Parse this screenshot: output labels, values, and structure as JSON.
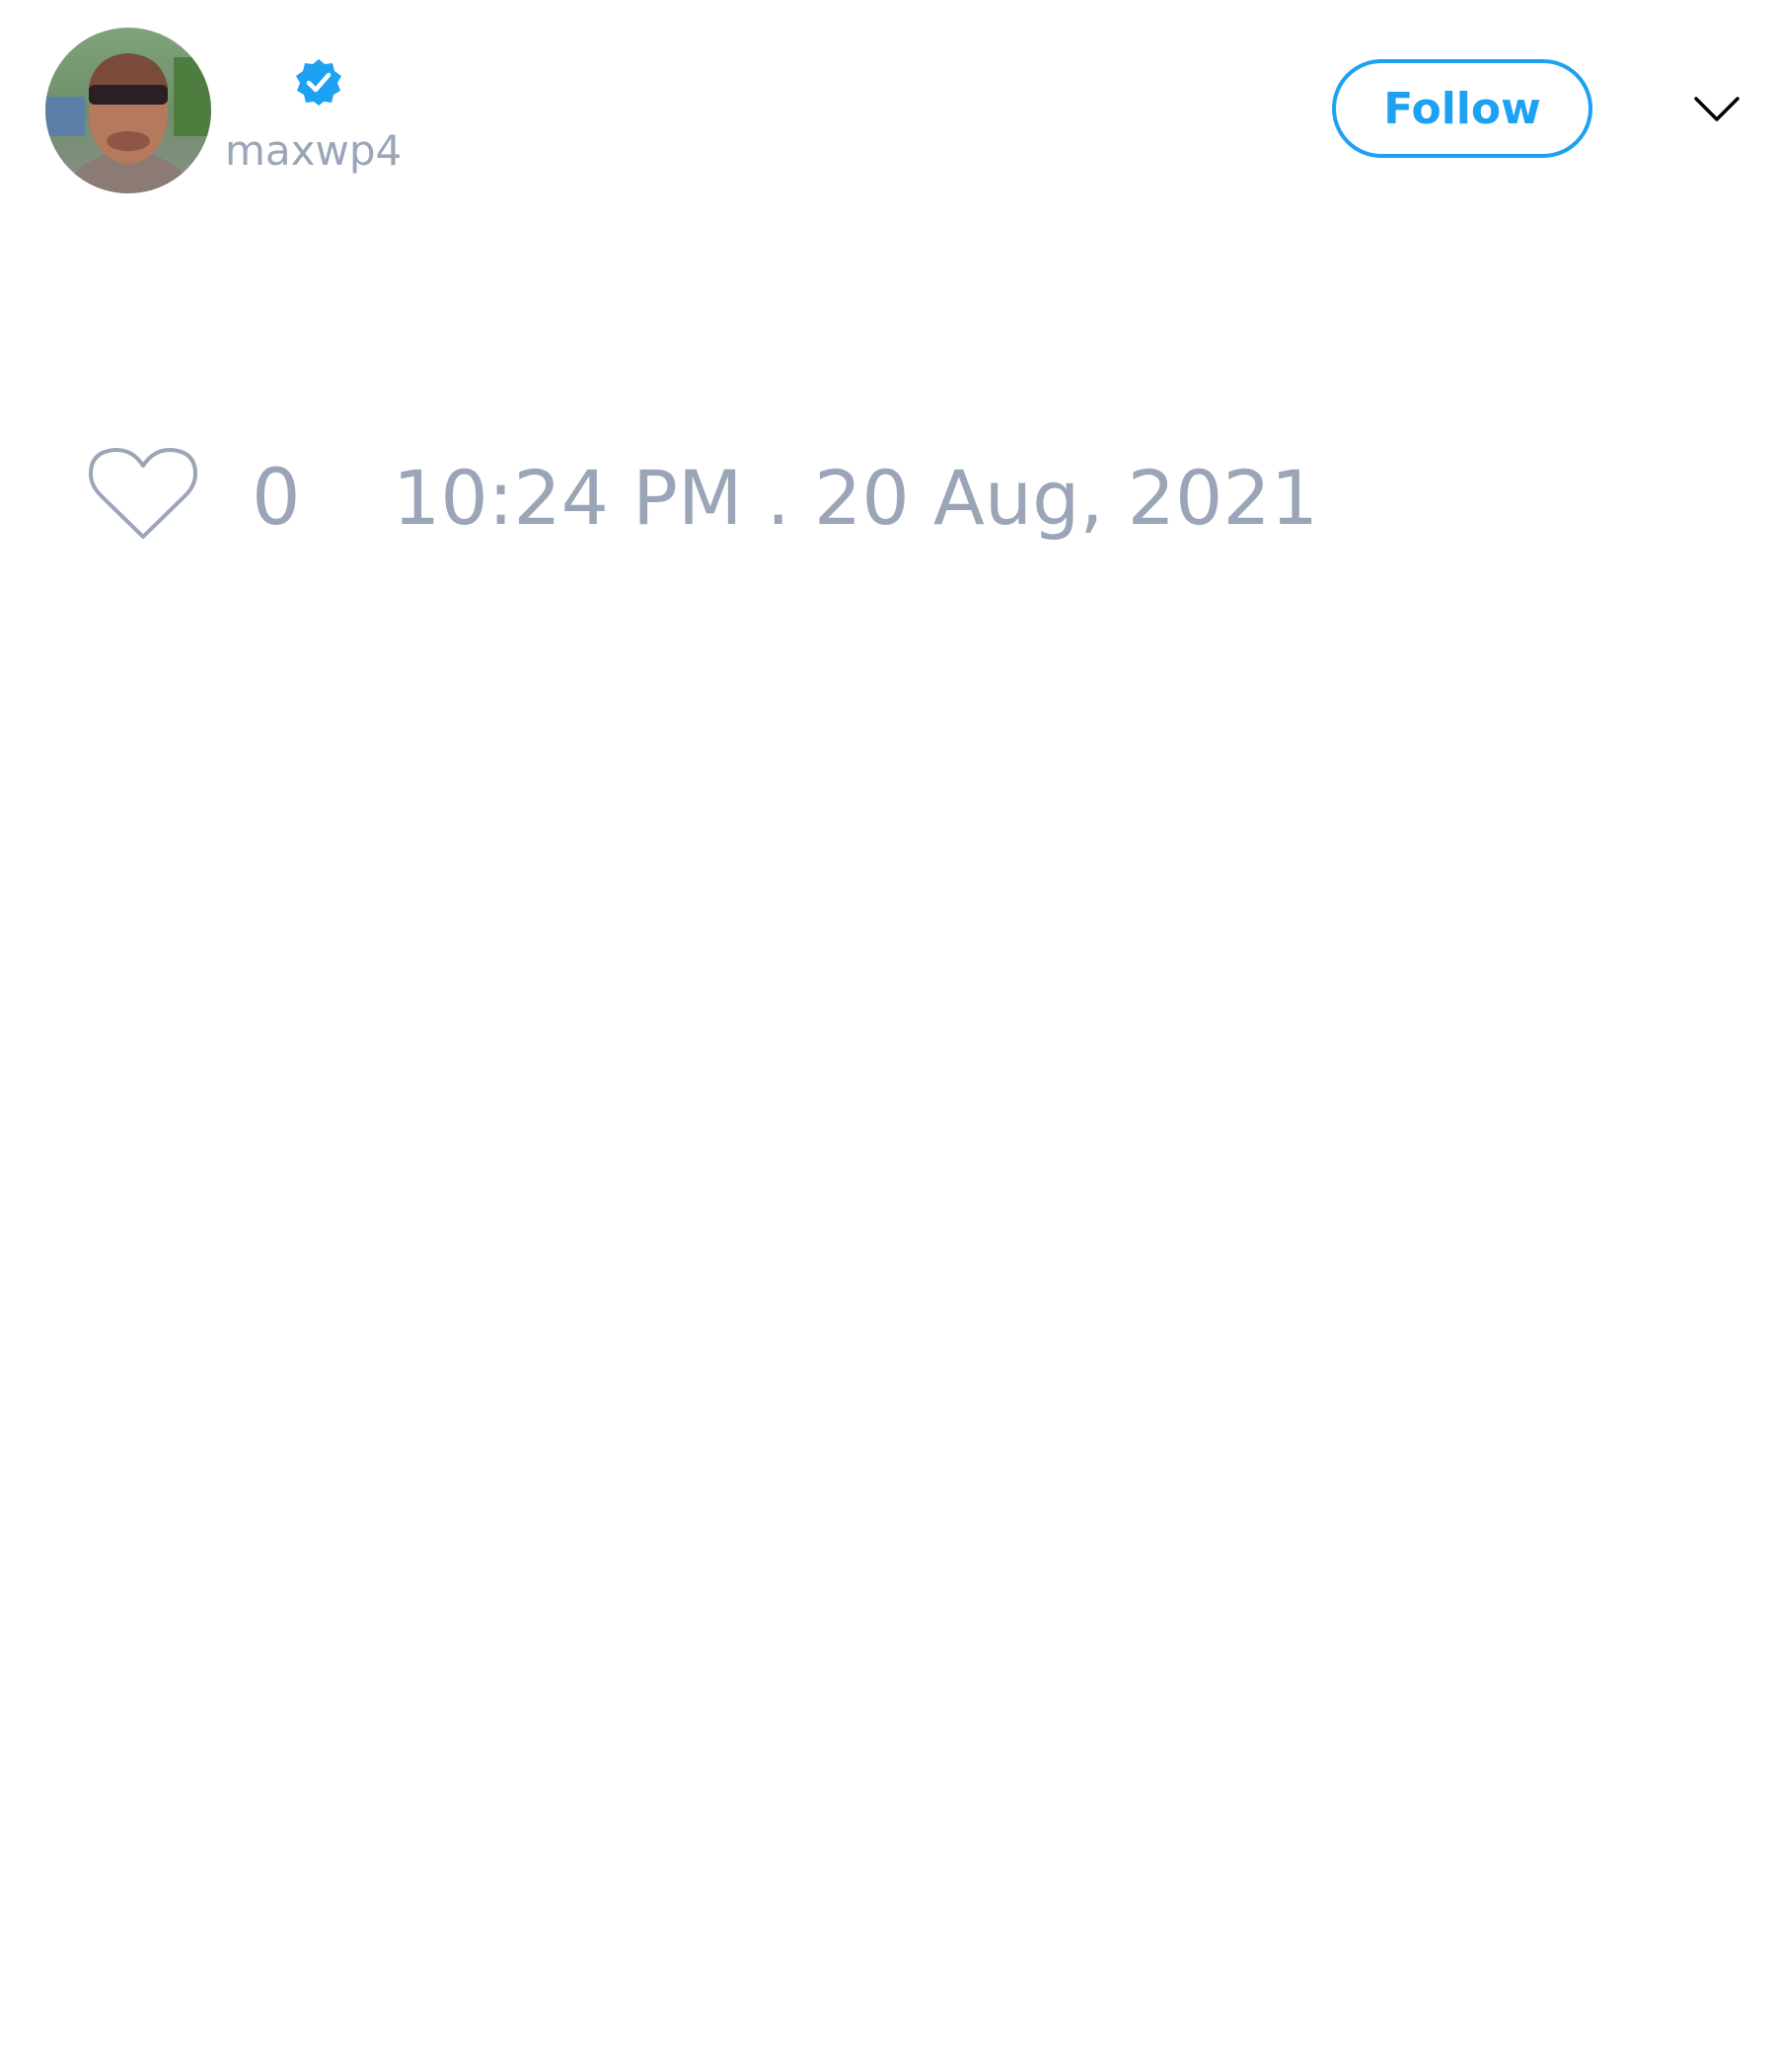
{
  "user": {
    "handle": "maxwp4",
    "verified": true,
    "avatar_icon": "user-avatar-photo"
  },
  "actions": {
    "follow_label": "Follow",
    "more_icon": "chevron-down-icon"
  },
  "tweet": {
    "likes": "0",
    "timestamp": "10:24 PM . 20 Aug, 2021"
  },
  "colors": {
    "accent": "#1da1f2",
    "muted_text": "#9aa5b8",
    "icon_outline": "#9aa5b8",
    "background": "#ffffff"
  }
}
